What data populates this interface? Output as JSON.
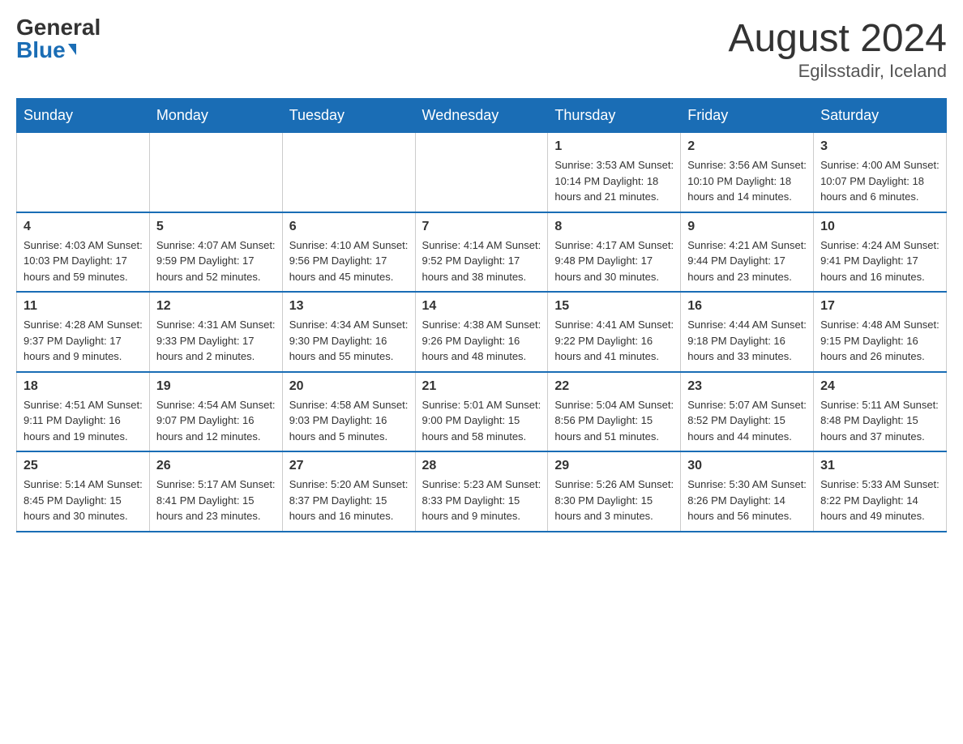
{
  "header": {
    "logo_general": "General",
    "logo_blue": "Blue",
    "month_title": "August 2024",
    "location": "Egilsstadir, Iceland"
  },
  "weekdays": [
    "Sunday",
    "Monday",
    "Tuesday",
    "Wednesday",
    "Thursday",
    "Friday",
    "Saturday"
  ],
  "weeks": [
    [
      {
        "day": "",
        "info": ""
      },
      {
        "day": "",
        "info": ""
      },
      {
        "day": "",
        "info": ""
      },
      {
        "day": "",
        "info": ""
      },
      {
        "day": "1",
        "info": "Sunrise: 3:53 AM\nSunset: 10:14 PM\nDaylight: 18 hours and 21 minutes."
      },
      {
        "day": "2",
        "info": "Sunrise: 3:56 AM\nSunset: 10:10 PM\nDaylight: 18 hours and 14 minutes."
      },
      {
        "day": "3",
        "info": "Sunrise: 4:00 AM\nSunset: 10:07 PM\nDaylight: 18 hours and 6 minutes."
      }
    ],
    [
      {
        "day": "4",
        "info": "Sunrise: 4:03 AM\nSunset: 10:03 PM\nDaylight: 17 hours and 59 minutes."
      },
      {
        "day": "5",
        "info": "Sunrise: 4:07 AM\nSunset: 9:59 PM\nDaylight: 17 hours and 52 minutes."
      },
      {
        "day": "6",
        "info": "Sunrise: 4:10 AM\nSunset: 9:56 PM\nDaylight: 17 hours and 45 minutes."
      },
      {
        "day": "7",
        "info": "Sunrise: 4:14 AM\nSunset: 9:52 PM\nDaylight: 17 hours and 38 minutes."
      },
      {
        "day": "8",
        "info": "Sunrise: 4:17 AM\nSunset: 9:48 PM\nDaylight: 17 hours and 30 minutes."
      },
      {
        "day": "9",
        "info": "Sunrise: 4:21 AM\nSunset: 9:44 PM\nDaylight: 17 hours and 23 minutes."
      },
      {
        "day": "10",
        "info": "Sunrise: 4:24 AM\nSunset: 9:41 PM\nDaylight: 17 hours and 16 minutes."
      }
    ],
    [
      {
        "day": "11",
        "info": "Sunrise: 4:28 AM\nSunset: 9:37 PM\nDaylight: 17 hours and 9 minutes."
      },
      {
        "day": "12",
        "info": "Sunrise: 4:31 AM\nSunset: 9:33 PM\nDaylight: 17 hours and 2 minutes."
      },
      {
        "day": "13",
        "info": "Sunrise: 4:34 AM\nSunset: 9:30 PM\nDaylight: 16 hours and 55 minutes."
      },
      {
        "day": "14",
        "info": "Sunrise: 4:38 AM\nSunset: 9:26 PM\nDaylight: 16 hours and 48 minutes."
      },
      {
        "day": "15",
        "info": "Sunrise: 4:41 AM\nSunset: 9:22 PM\nDaylight: 16 hours and 41 minutes."
      },
      {
        "day": "16",
        "info": "Sunrise: 4:44 AM\nSunset: 9:18 PM\nDaylight: 16 hours and 33 minutes."
      },
      {
        "day": "17",
        "info": "Sunrise: 4:48 AM\nSunset: 9:15 PM\nDaylight: 16 hours and 26 minutes."
      }
    ],
    [
      {
        "day": "18",
        "info": "Sunrise: 4:51 AM\nSunset: 9:11 PM\nDaylight: 16 hours and 19 minutes."
      },
      {
        "day": "19",
        "info": "Sunrise: 4:54 AM\nSunset: 9:07 PM\nDaylight: 16 hours and 12 minutes."
      },
      {
        "day": "20",
        "info": "Sunrise: 4:58 AM\nSunset: 9:03 PM\nDaylight: 16 hours and 5 minutes."
      },
      {
        "day": "21",
        "info": "Sunrise: 5:01 AM\nSunset: 9:00 PM\nDaylight: 15 hours and 58 minutes."
      },
      {
        "day": "22",
        "info": "Sunrise: 5:04 AM\nSunset: 8:56 PM\nDaylight: 15 hours and 51 minutes."
      },
      {
        "day": "23",
        "info": "Sunrise: 5:07 AM\nSunset: 8:52 PM\nDaylight: 15 hours and 44 minutes."
      },
      {
        "day": "24",
        "info": "Sunrise: 5:11 AM\nSunset: 8:48 PM\nDaylight: 15 hours and 37 minutes."
      }
    ],
    [
      {
        "day": "25",
        "info": "Sunrise: 5:14 AM\nSunset: 8:45 PM\nDaylight: 15 hours and 30 minutes."
      },
      {
        "day": "26",
        "info": "Sunrise: 5:17 AM\nSunset: 8:41 PM\nDaylight: 15 hours and 23 minutes."
      },
      {
        "day": "27",
        "info": "Sunrise: 5:20 AM\nSunset: 8:37 PM\nDaylight: 15 hours and 16 minutes."
      },
      {
        "day": "28",
        "info": "Sunrise: 5:23 AM\nSunset: 8:33 PM\nDaylight: 15 hours and 9 minutes."
      },
      {
        "day": "29",
        "info": "Sunrise: 5:26 AM\nSunset: 8:30 PM\nDaylight: 15 hours and 3 minutes."
      },
      {
        "day": "30",
        "info": "Sunrise: 5:30 AM\nSunset: 8:26 PM\nDaylight: 14 hours and 56 minutes."
      },
      {
        "day": "31",
        "info": "Sunrise: 5:33 AM\nSunset: 8:22 PM\nDaylight: 14 hours and 49 minutes."
      }
    ]
  ]
}
